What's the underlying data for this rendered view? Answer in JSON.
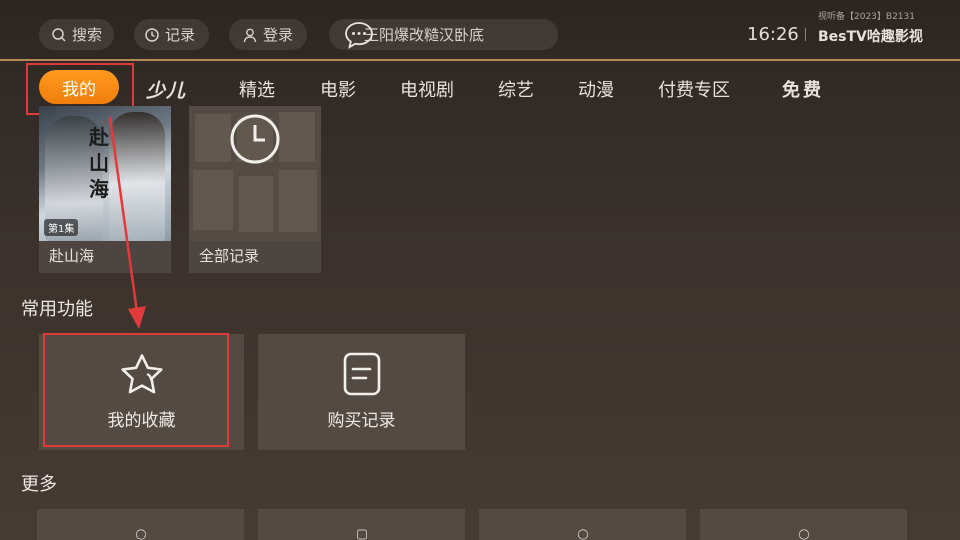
{
  "header": {
    "search_label": "搜索",
    "history_label": "记录",
    "login_label": "登录",
    "marquee_text": "王阳爆改糙汉卧底",
    "time": "16:26",
    "license": "视听备【2023】B2131",
    "brand": "BesTV哈趣影视"
  },
  "nav": {
    "tabs": [
      "我的",
      "少儿",
      "精选",
      "电影",
      "电视剧",
      "综艺",
      "动漫",
      "付费专区",
      "免费"
    ],
    "active_index": 0
  },
  "history": {
    "items": [
      {
        "title": "赴山海",
        "episode_badge": "第1集",
        "poster_text": "赴山海"
      },
      {
        "title": "全部记录"
      }
    ]
  },
  "common": {
    "title": "常用功能",
    "items": [
      {
        "label": "我的收藏",
        "icon": "star-icon"
      },
      {
        "label": "购买记录",
        "icon": "document-icon"
      }
    ]
  },
  "more": {
    "title": "更多"
  },
  "colors": {
    "accent": "#ff9a1f",
    "annotation": "#e23a3a",
    "divider": "#b38a55"
  }
}
